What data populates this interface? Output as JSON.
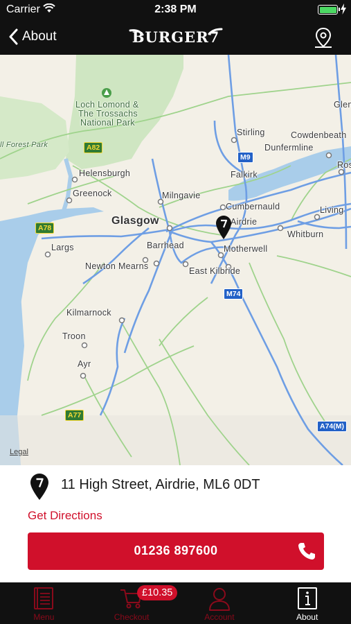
{
  "status_bar": {
    "carrier": "Carrier",
    "time": "2:38 PM"
  },
  "nav": {
    "back_label": "About",
    "brand": "BURGER7"
  },
  "map": {
    "labels": {
      "loch_lomond": "Loch Lomond &",
      "trossachs": "The Trossachs",
      "national_park": "National Park",
      "forest_park": "ll Forest Park",
      "glen": "Glen",
      "stirling": "Stirling",
      "cowdenbeath": "Cowdenbeath",
      "dunfermline": "Dunfermline",
      "ros": "Ros",
      "helensburgh": "Helensburgh",
      "falkirk": "Falkirk",
      "greenock": "Greenock",
      "milngavie": "Milngavie",
      "cumbernauld": "Cumbernauld",
      "living": "Living",
      "glasgow": "Glasgow",
      "airdrie": "Airdrie",
      "whitburn": "Whitburn",
      "largs": "Largs",
      "barrhead": "Barrhead",
      "motherwell": "Motherwell",
      "newton_mearns": "Newton Mearns",
      "east_kilbride": "East Kilbride",
      "kilmarnock": "Kilmarnock",
      "troon": "Troon",
      "ayr": "Ayr"
    },
    "roads": {
      "a82": "A82",
      "m9": "M9",
      "a78": "A78",
      "m74": "M74",
      "a77": "A77",
      "a74m": "A74(M)"
    },
    "legal": "Legal"
  },
  "store": {
    "address": "11 High Street, Airdrie, ML6 0DT",
    "directions_label": "Get Directions",
    "phone": "01236 897600"
  },
  "tabs": {
    "menu": "Menu",
    "checkout": "Checkout",
    "account": "Account",
    "about": "About"
  },
  "cart": {
    "total": "£10.35"
  },
  "colors": {
    "accent": "#d0102b",
    "bar_background": "#111111",
    "tab_inactive": "#8a0a1b"
  }
}
